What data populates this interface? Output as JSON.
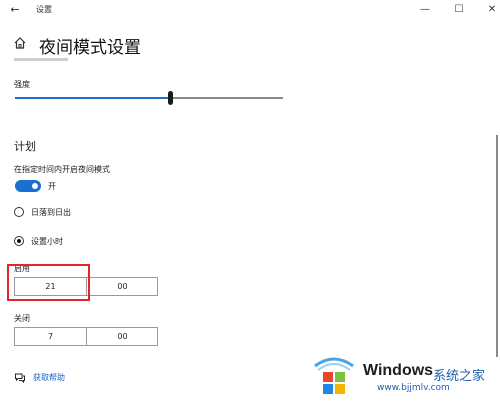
{
  "window": {
    "title": "设置",
    "back_glyph": "←",
    "minimize_glyph": "—",
    "maximize_glyph": "☐",
    "close_glyph": "✕"
  },
  "header": {
    "home_icon": "home-icon",
    "title": "夜间模式设置"
  },
  "strength": {
    "label": "强度",
    "value_fraction": 0.58,
    "accent_color": "#1a6fd0"
  },
  "schedule": {
    "section_title": "计划",
    "toggle_caption": "在指定时间内开启夜间模式",
    "toggle_state_label": "开",
    "toggle_on": true,
    "options": [
      {
        "label": "日落到日出",
        "checked": false
      },
      {
        "label": "设置小时",
        "checked": true
      }
    ],
    "turn_on": {
      "label": "启用",
      "hour": "21",
      "minute": "00"
    },
    "turn_off": {
      "label": "关闭",
      "hour": "7",
      "minute": "00"
    },
    "highlight_color": "#e0262b"
  },
  "help": {
    "icon": "help-chat-icon",
    "label": "获取帮助",
    "link_color": "#1a63c6"
  },
  "watermark": {
    "brand": "Windows",
    "cn": "系统之家",
    "url": "www.bjjmlv.com"
  }
}
